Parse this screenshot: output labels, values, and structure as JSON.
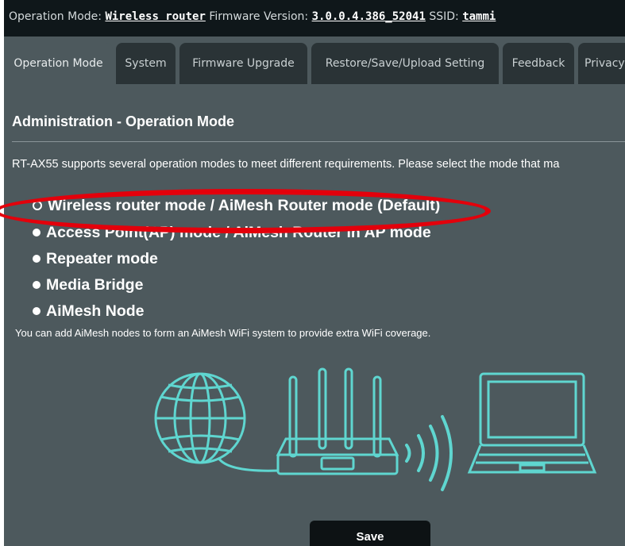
{
  "topbar": {
    "mode_label": "Operation Mode:",
    "mode_value": "Wireless router",
    "fw_label": "Firmware Version:",
    "fw_value": "3.0.0.4.386_52041",
    "ssid_label": "SSID:",
    "ssid_value": "tammi"
  },
  "tabs": [
    {
      "label": "Operation Mode",
      "active": true
    },
    {
      "label": "System"
    },
    {
      "label": "Firmware Upgrade"
    },
    {
      "label": "Restore/Save/Upload Setting"
    },
    {
      "label": "Feedback"
    },
    {
      "label": "Privacy"
    }
  ],
  "page": {
    "title": "Administration - Operation Mode",
    "description": "RT-AX55 supports several operation modes to meet different requirements. Please select the mode that ma",
    "modes": [
      {
        "label": "Wireless router mode / AiMesh Router mode (Default)",
        "selected": true
      },
      {
        "label": "Access Point(AP) mode / AiMesh Router in AP mode",
        "selected": false
      },
      {
        "label": "Repeater mode",
        "selected": false
      },
      {
        "label": "Media Bridge",
        "selected": false
      },
      {
        "label": "AiMesh Node",
        "selected": false
      }
    ],
    "note": "You can add AiMesh nodes to form an AiMesh WiFi system to provide extra WiFi coverage.",
    "save_label": "Save"
  },
  "colors": {
    "background": "#4d595d",
    "topbar": "#0f171a",
    "tab": "#2a3336",
    "illustration": "#5fd6d0",
    "highlight": "#e3000b"
  }
}
